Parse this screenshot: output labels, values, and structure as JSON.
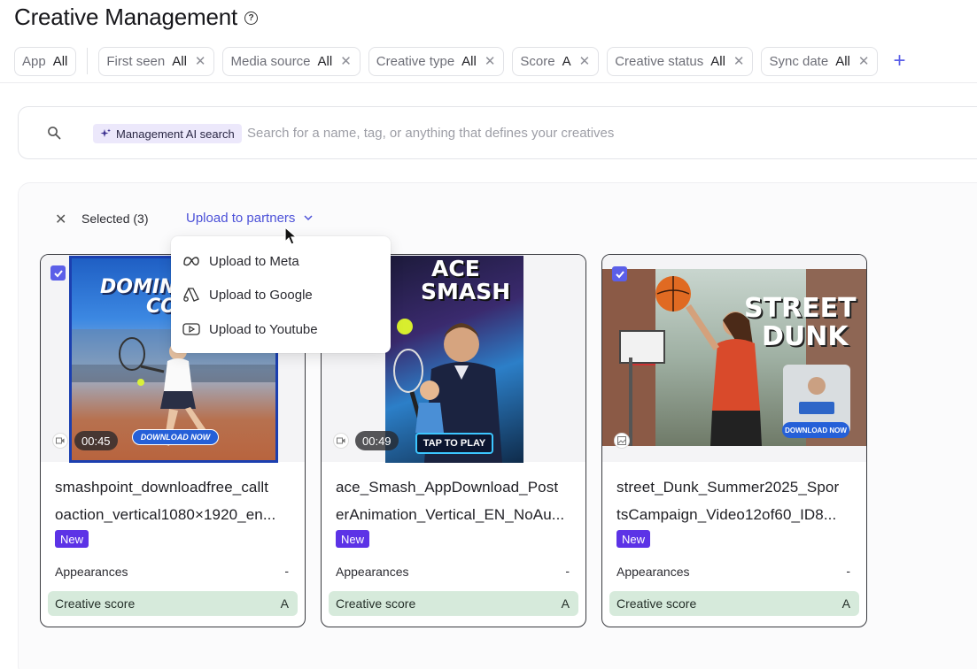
{
  "page": {
    "title": "Creative Management",
    "help_icon": "question-circle-icon"
  },
  "filters": [
    {
      "label": "App",
      "value": "All",
      "removable": false
    },
    {
      "label": "First seen",
      "value": "All",
      "removable": true
    },
    {
      "label": "Media source",
      "value": "All",
      "removable": true
    },
    {
      "label": "Creative type",
      "value": "All",
      "removable": true
    },
    {
      "label": "Score",
      "value": "A",
      "removable": true
    },
    {
      "label": "Creative status",
      "value": "All",
      "removable": true
    },
    {
      "label": "Sync date",
      "value": "All",
      "removable": true
    }
  ],
  "search": {
    "ai_badge": "Management AI search",
    "placeholder": "Search for a name, tag, or anything that defines your creatives"
  },
  "selection": {
    "label": "Selected (3)",
    "action": "Upload to partners"
  },
  "dropdown": {
    "items": [
      {
        "label": "Upload to Meta",
        "icon": "meta-icon"
      },
      {
        "label": "Upload to Google",
        "icon": "google-ads-icon"
      },
      {
        "label": "Upload to Youtube",
        "icon": "youtube-icon"
      }
    ]
  },
  "cards": [
    {
      "name_line1": "smashpoint_downloadfree_callt",
      "name_line2": "oaction_vertical1080×1920_en...",
      "duration": "00:45",
      "media_type": "video-icon",
      "selected": true,
      "badge": "New",
      "appearances_label": "Appearances",
      "appearances_value": "-",
      "score_label": "Creative score",
      "score_value": "A",
      "overlay_title": "DOMINA",
      "overlay_sub": "CO",
      "cta": "DOWNLOAD NOW"
    },
    {
      "name_line1": "ace_Smash_AppDownload_Post",
      "name_line2": "erAnimation_Vertical_EN_NoAu...",
      "duration": "00:49",
      "media_type": "video-icon",
      "selected": false,
      "badge": "New",
      "appearances_label": "Appearances",
      "appearances_value": "-",
      "score_label": "Creative score",
      "score_value": "A",
      "overlay_title": "ACE",
      "overlay_sub": "SMASH",
      "cta": "TAP TO PLAY"
    },
    {
      "name_line1": "street_Dunk_Summer2025_Spor",
      "name_line2": "tsCampaign_Video12of60_ID8...",
      "duration": "",
      "media_type": "image-icon",
      "selected": true,
      "badge": "New",
      "appearances_label": "Appearances",
      "appearances_value": "-",
      "score_label": "Creative score",
      "score_value": "A",
      "overlay_title": "STREET",
      "overlay_sub": "DUNK",
      "cta": "DOWNLOAD NOW"
    }
  ],
  "colors": {
    "accent": "#5b5fe8",
    "badge": "#5c33e6",
    "score_bg": "#d6eadb",
    "link": "#4c51d8"
  }
}
